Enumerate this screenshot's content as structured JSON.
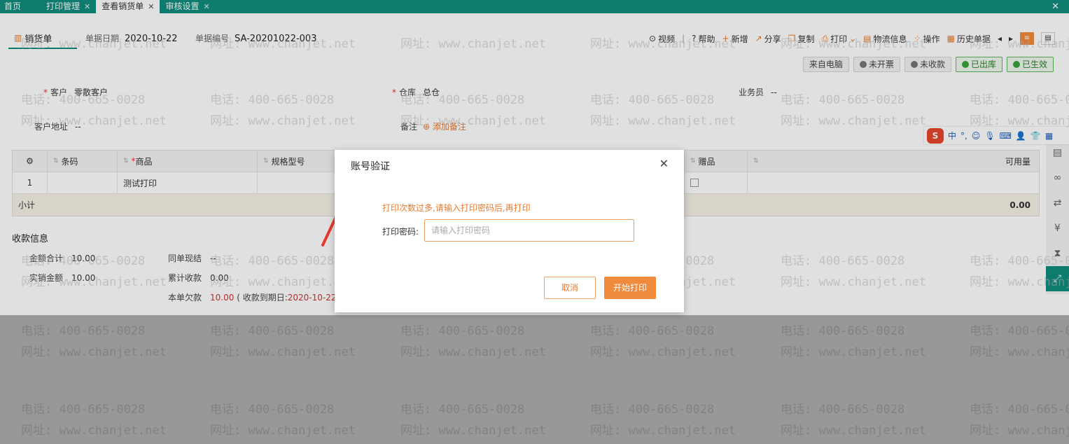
{
  "tabs": [
    {
      "label": "首页",
      "closable": false,
      "active": false
    },
    {
      "label": "打印管理",
      "closable": true,
      "active": false
    },
    {
      "label": "查看销货单",
      "closable": true,
      "active": true
    },
    {
      "label": "审核设置",
      "closable": true,
      "active": false
    }
  ],
  "header": {
    "doc_type": "销货单",
    "date_label": "单据日期",
    "date_value": "2020-10-22",
    "no_label": "单据编号",
    "no_value": "SA-20201022-003"
  },
  "toolbar": {
    "video": "视频",
    "help": "帮助",
    "new": "新增",
    "share": "分享",
    "copy": "复制",
    "print": "打印",
    "logistics": "物流信息",
    "operate": "操作",
    "history": "历史单据"
  },
  "badges": {
    "source": "来自电脑",
    "invoice": "未开票",
    "receipt": "未收款",
    "outbound": "已出库",
    "effective": "已生效"
  },
  "form": {
    "customer_label": "客户",
    "customer_value": "零散客户",
    "warehouse_label": "仓库",
    "warehouse_value": "总仓",
    "salesman_label": "业务员",
    "salesman_value": "--",
    "address_label": "客户地址",
    "address_value": "--",
    "remark_label": "备注",
    "remark_add": "添加备注"
  },
  "table": {
    "headers": {
      "barcode": "条码",
      "product": "商品",
      "spec": "规格型号",
      "gift": "赠品",
      "available": "可用量"
    },
    "row": {
      "index": "1",
      "product": "测试打印"
    },
    "subtotal_label": "小计",
    "subtotal_value": "0.00"
  },
  "payment": {
    "title": "收款信息",
    "total_label": "金额合计",
    "total_value": "10.00",
    "actual_label": "实销金额",
    "actual_value": "10.00",
    "settle_label": "同单现结",
    "settle_value": "--",
    "collected_label": "累计收款",
    "collected_value": "0.00",
    "owed_label": "本单欠款",
    "owed_value": "10.00",
    "owed_note_prefix": "( 收款到期日:",
    "owed_due": "2020-10-22"
  },
  "ime": {
    "logo": "S",
    "mode": "中",
    "punct": "°,"
  },
  "watermark": {
    "phone": "电话: 400-665-0028",
    "site": "网址: www.chanjet.net"
  },
  "dialog": {
    "title": "账号验证",
    "tip": "打印次数过多,请输入打印密码后,再打印",
    "password_label": "打印密码:",
    "password_placeholder": "请输入打印密码",
    "cancel": "取消",
    "confirm": "开始打印"
  },
  "colors": {
    "brand": "#0f8c7d",
    "accent": "#f08a3c",
    "tip": "#e87a2f",
    "arrow": "#e53a2b"
  }
}
